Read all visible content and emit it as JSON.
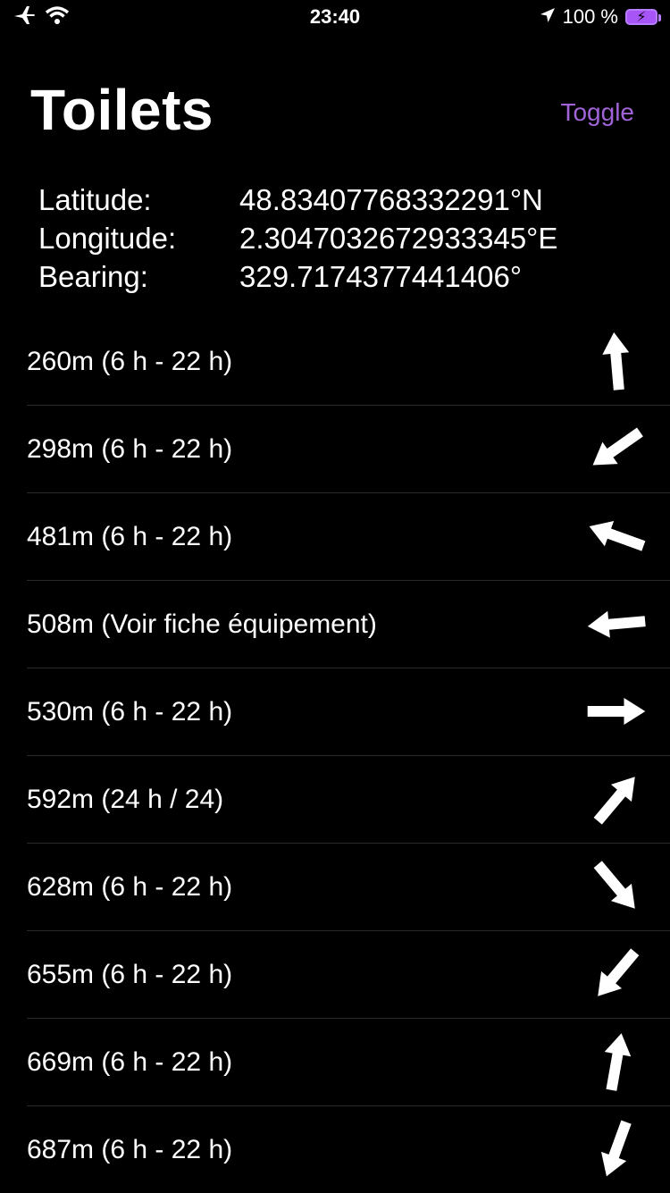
{
  "status_bar": {
    "time": "23:40",
    "battery_text": "100 %",
    "icons": [
      "airplane-icon",
      "wifi-icon",
      "location-arrow-icon",
      "battery-charging-icon"
    ]
  },
  "header": {
    "title": "Toilets",
    "toggle_label": "Toggle",
    "accent_color": "#a064d8"
  },
  "location": {
    "latitude_label": "Latitude:",
    "latitude_value": "48.83407768332291°N",
    "longitude_label": "Longitude:",
    "longitude_value": "2.3047032672933345°E",
    "bearing_label": "Bearing:",
    "bearing_value": "329.7174377441406°"
  },
  "toilets": [
    {
      "label": "260m (6 h - 22 h)",
      "direction_deg": -5
    },
    {
      "label": "298m (6 h - 22 h)",
      "direction_deg": -125
    },
    {
      "label": "481m (6 h - 22 h)",
      "direction_deg": -70
    },
    {
      "label": "508m (Voir fiche équipement)",
      "direction_deg": -95
    },
    {
      "label": "530m (6 h - 22 h)",
      "direction_deg": 90
    },
    {
      "label": "592m (24 h / 24)",
      "direction_deg": 40
    },
    {
      "label": "628m (6 h - 22 h)",
      "direction_deg": 140
    },
    {
      "label": "655m (6 h - 22 h)",
      "direction_deg": -140
    },
    {
      "label": "669m (6 h - 22 h)",
      "direction_deg": 10
    },
    {
      "label": "687m (6 h - 22 h)",
      "direction_deg": -160
    }
  ]
}
